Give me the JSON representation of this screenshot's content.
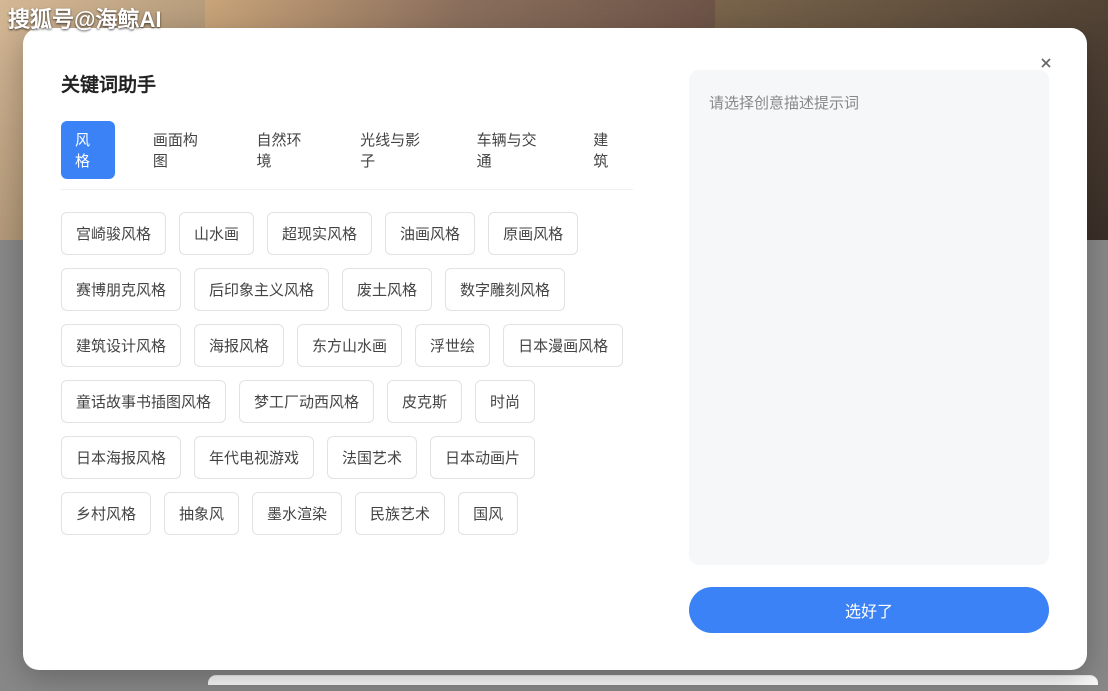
{
  "watermark": "搜狐号@海鲸AI",
  "modal": {
    "title": "关键词助手",
    "tabs": [
      {
        "label": "风格",
        "active": true
      },
      {
        "label": "画面构图",
        "active": false
      },
      {
        "label": "自然环境",
        "active": false
      },
      {
        "label": "光线与影子",
        "active": false
      },
      {
        "label": "车辆与交通",
        "active": false
      },
      {
        "label": "建筑",
        "active": false
      }
    ],
    "tags": [
      "宫崎骏风格",
      "山水画",
      "超现实风格",
      "油画风格",
      "原画风格",
      "赛博朋克风格",
      "后印象主义风格",
      "废土风格",
      "数字雕刻风格",
      "建筑设计风格",
      "海报风格",
      "东方山水画",
      "浮世绘",
      "日本漫画风格",
      "童话故事书插图风格",
      "梦工厂动西风格",
      "皮克斯",
      "时尚",
      "日本海报风格",
      "年代电视游戏",
      "法国艺术",
      "日本动画片",
      "乡村风格",
      "抽象风",
      "墨水渲染",
      "民族艺术",
      "国风"
    ],
    "promptPlaceholder": "请选择创意描述提示词",
    "confirmLabel": "选好了"
  }
}
